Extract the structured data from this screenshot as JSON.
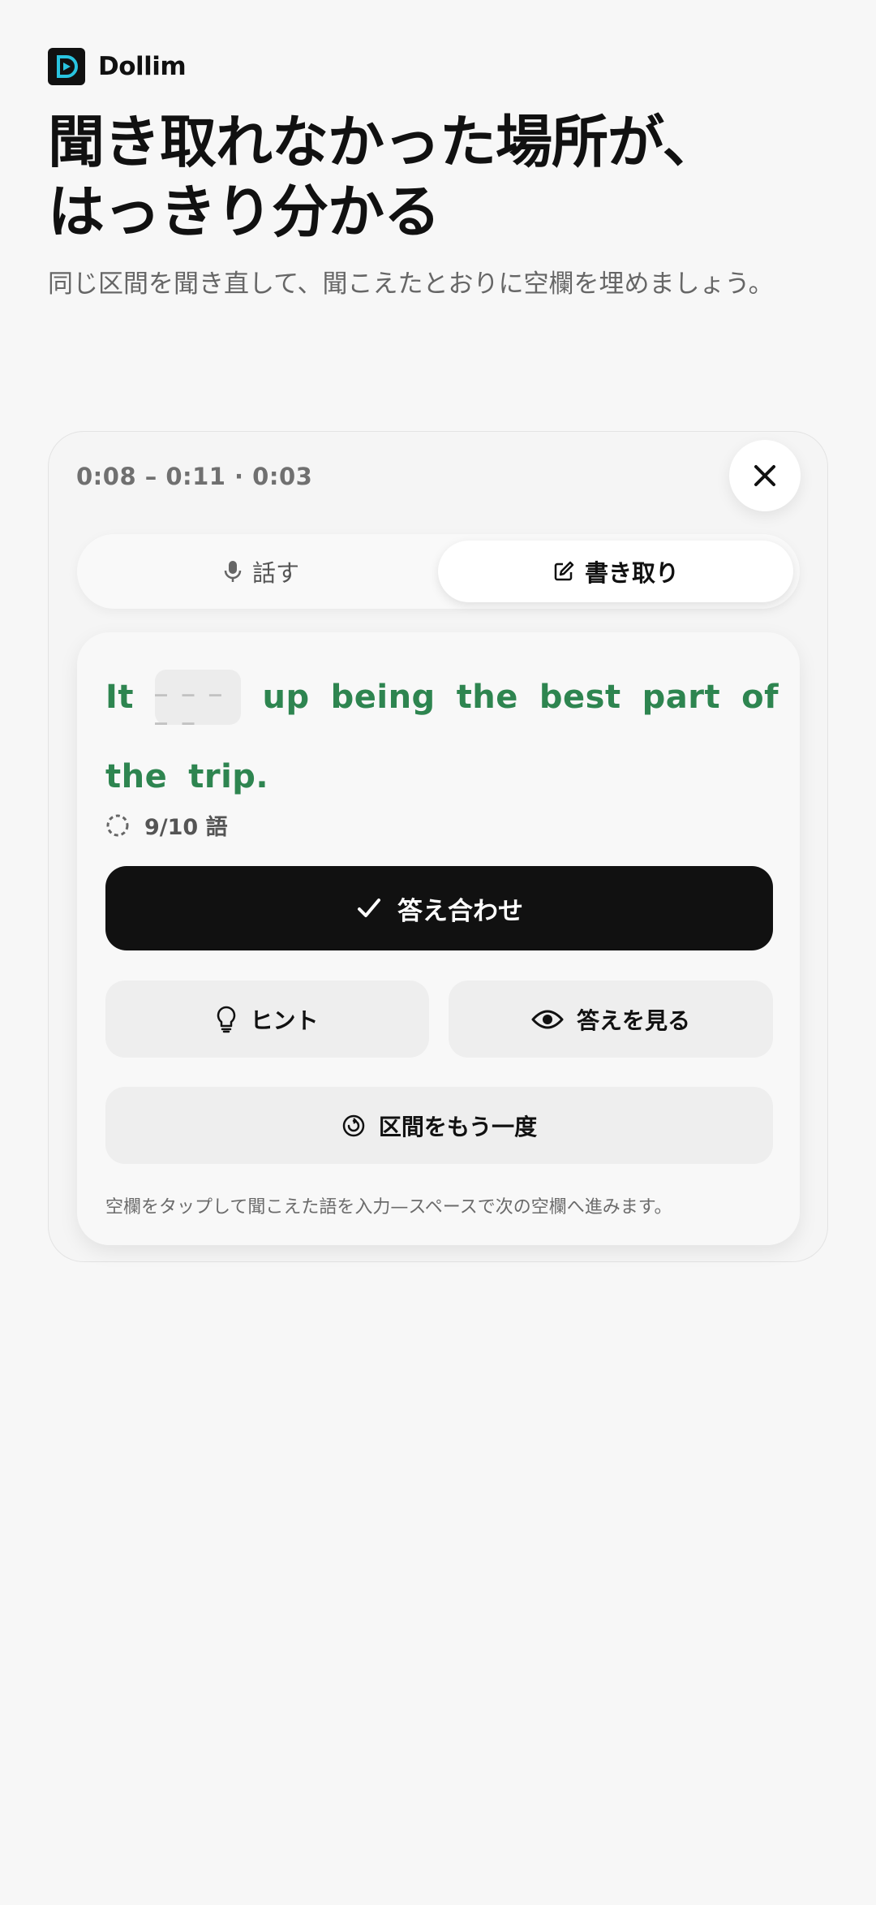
{
  "brand": {
    "name": "Dollim",
    "logo_icon": "dollim-logo-icon",
    "accent": "#29c4e0"
  },
  "hero": {
    "title_line1": "聞き取れなかった場所が、",
    "title_line2": "はっきり分かる",
    "subtitle": "同じ区間を聞き直して、聞こえたとおりに空欄を埋めましょう。"
  },
  "card": {
    "time_range": "0:08 – 0:11 · 0:03",
    "tabs": [
      {
        "label": "話す",
        "icon": "microphone-icon",
        "active": false
      },
      {
        "label": "書き取り",
        "icon": "edit-icon",
        "active": true
      }
    ],
    "sentence": {
      "line1": [
        "It",
        "up",
        "being",
        "the",
        "best",
        "part",
        "of"
      ],
      "line2": [
        "the",
        "trip."
      ],
      "blank_placeholder": "_ _ _ _ _",
      "color": "#2e8550"
    },
    "progress_text": "9/10 語",
    "check_button": "答え合わせ",
    "hint_button": "ヒント",
    "show_answer_button": "答えを見る",
    "replay_button": "区間をもう一度",
    "footnote": "空欄をタップして聞こえた語を入力—スペースで次の空欄へ進みます。"
  }
}
